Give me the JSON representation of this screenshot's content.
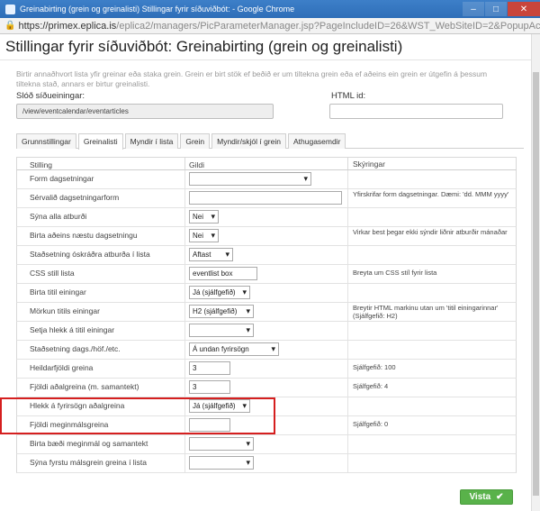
{
  "window": {
    "title": "Greinabirting (grein og greinalisti) Stillingar fyrir síðuviðbót: - Google Chrome",
    "minimize_icon": "minimize-icon",
    "maximize_icon": "maximize-icon",
    "close_icon": "close-icon"
  },
  "address": {
    "host": "https://primex.eplica.is",
    "path": "/eplica2/managers/PicParameterManager.jsp?PageIncludeID=26&WST_WebSiteID=2&PopupAction=",
    "icon": "lock-icon"
  },
  "page": {
    "heading": "Stillingar fyrir síðuviðbót: Greinabirting (grein og greinalisti)",
    "description": "Birtir annaðhvort lista yfir greinar eða staka grein. Grein er birt stök ef beðið er um tiltekna grein eða ef aðeins ein grein er útgefin á þessum tiltekna stað, annars er birtur greinalisti.",
    "path_label": "Slóð síðueiningar:",
    "path_value": "/view/eventcalendar/eventarticles",
    "html_id_label": "HTML id:",
    "html_id_value": ""
  },
  "tabs": [
    "Grunnstillingar",
    "Greinalisti",
    "Myndir í lista",
    "Grein",
    "Myndir/skjól í grein",
    "Athugasemdir"
  ],
  "active_tab": "Greinalisti",
  "table": {
    "headers": [
      "Stilling",
      "Gildi",
      "Skýringar"
    ],
    "rows": [
      {
        "label": "Form dagsetningar",
        "kind": "select",
        "value": "",
        "note": ""
      },
      {
        "label": "Sérvalið dagsetningarform",
        "kind": "input",
        "value": "",
        "note": "Yfirskrifar form dagsetningar. Dæmi: 'dd. MMM yyyy'"
      },
      {
        "label": "Sýna alla atburði",
        "kind": "select",
        "value": "Nei",
        "note": ""
      },
      {
        "label": "Birta aðeins næstu dagsetningu",
        "kind": "select",
        "value": "Nei",
        "note": "Virkar best þegar ekki sýndir liðnir atburðir mánaðar"
      },
      {
        "label": "Staðsetning óskráðra atburða í lista",
        "kind": "select",
        "value": "Aftast",
        "note": ""
      },
      {
        "label": "CSS still lista",
        "kind": "input",
        "value": "eventlist box",
        "note": "Breyta um CSS stíl fyrir lista"
      },
      {
        "label": "Birta titil einingar",
        "kind": "select",
        "value": "Já (sjálfgefið)",
        "note": ""
      },
      {
        "label": "Mörkun titils einingar",
        "kind": "select",
        "value": "H2 (sjálfgefið)",
        "note": "Breytir HTML markinu utan um 'titil einingarinnar' (Sjálfgefið: H2)"
      },
      {
        "label": "Setja hlekk á titil einingar",
        "kind": "select",
        "value": "",
        "note": ""
      },
      {
        "label": "Staðsetning dags./höf./etc.",
        "kind": "select",
        "value": "Á undan fyrirsögn",
        "note": ""
      },
      {
        "label": "Heildarfjöldi greina",
        "kind": "input",
        "value": "3",
        "note": "Sjálfgefið: 100"
      },
      {
        "label": "Fjöldi aðalgreina (m. samantekt)",
        "kind": "input",
        "value": "3",
        "note": "Sjálfgefið: 4"
      },
      {
        "label": "Hlekk á fyrirsögn aðalgreina",
        "kind": "select",
        "value": "Já (sjálfgefið)",
        "note": ""
      },
      {
        "label": "Fjöldi meginmálsgreina",
        "kind": "input",
        "value": "",
        "note": "Sjálfgefið: 0"
      },
      {
        "label": "Birta bæði meginmál og samantekt",
        "kind": "select",
        "value": "",
        "note": ""
      },
      {
        "label": "Sýna fyrstu málsgrein greina í lista",
        "kind": "select",
        "value": "",
        "note": ""
      }
    ]
  },
  "footer": {
    "vista_label": "Vista",
    "vista_icon": "check-icon"
  },
  "colors": {
    "titlebar": "#2e6eb8",
    "highlight": "#d51f1f",
    "vista": "#59b24a"
  }
}
